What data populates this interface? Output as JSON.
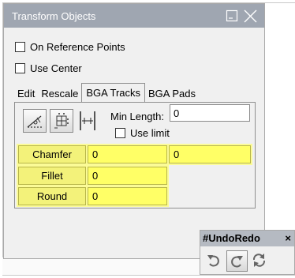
{
  "window": {
    "title": "Transform Objects"
  },
  "options": {
    "on_reference_points": "On Reference Points",
    "use_center": "Use Center"
  },
  "tabs": [
    {
      "label": "Edit"
    },
    {
      "label": "Rescale"
    },
    {
      "label": "BGA Tracks",
      "active": true
    },
    {
      "label": "BGA Pads"
    }
  ],
  "bga_tracks": {
    "min_length_label": "Min Length:",
    "min_length_value": "0",
    "use_limit_label": "Use limit",
    "rows": [
      {
        "label": "Chamfer",
        "value1": "0",
        "value2": "0"
      },
      {
        "label": "Fillet",
        "value1": "0"
      },
      {
        "label": "Round",
        "value1": "0"
      }
    ]
  },
  "undo_redo": {
    "title": "#UndoRedo",
    "close": "×"
  },
  "colors": {
    "titlebar": "#9fa6b1",
    "highlight_yellow": "#ffff66",
    "label_yellow": "#f3f27a"
  }
}
